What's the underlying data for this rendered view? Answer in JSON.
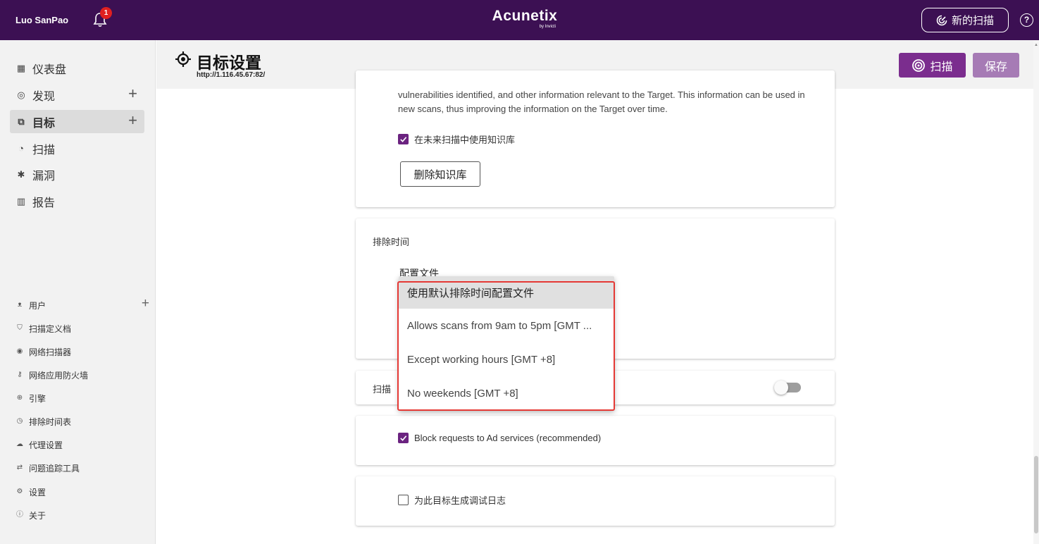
{
  "header": {
    "user_name": "Luo SanPao",
    "notification_count": "1",
    "logo_main": "Acunetix",
    "logo_sub": "by Invicti",
    "new_scan_label": "新的扫描",
    "help_label": "?"
  },
  "sidebar": {
    "nav": [
      {
        "label": "仪表盘",
        "icon": "dashboard-icon"
      },
      {
        "label": "发现",
        "icon": "discovery-icon"
      },
      {
        "label": "目标",
        "icon": "targets-icon"
      },
      {
        "label": "扫描",
        "icon": "scans-icon"
      },
      {
        "label": "漏洞",
        "icon": "bug-icon"
      },
      {
        "label": "报告",
        "icon": "reports-icon"
      }
    ],
    "settings": [
      {
        "label": "用户",
        "icon": "user-icon"
      },
      {
        "label": "扫描定义档",
        "icon": "shield-icon"
      },
      {
        "label": "网络扫描器",
        "icon": "network-scanner-icon"
      },
      {
        "label": "网络应用防火墙",
        "icon": "key-icon"
      },
      {
        "label": "引擎",
        "icon": "engine-icon"
      },
      {
        "label": "排除时间表",
        "icon": "clock-icon"
      },
      {
        "label": "代理设置",
        "icon": "proxy-icon"
      },
      {
        "label": "问题追踪工具",
        "icon": "issue-tracker-icon"
      },
      {
        "label": "设置",
        "icon": "gear-icon"
      },
      {
        "label": "关于",
        "icon": "info-icon"
      }
    ]
  },
  "page": {
    "title": "目标设置",
    "url": "http://1.116.45.67:82/",
    "scan_button": "扫描",
    "save_button": "保存"
  },
  "knowledge_base": {
    "text": "vulnerabilities identified, and other information relevant to the Target. This information can be used in new scans, thus improving the information on the Target over time.",
    "use_in_future_label": "在未来扫描中使用知识库",
    "use_in_future_checked": true,
    "delete_button": "删除知识库"
  },
  "excluded_hours": {
    "section_label": "排除时间",
    "profile_label": "配置文件",
    "options": [
      "使用默认排除时间配置文件",
      "Allows scans from 9am to 5pm [GMT ...",
      "Except working hours [GMT +8]",
      "No weekends [GMT +8]"
    ],
    "selected_index": 0
  },
  "scan_speed_row": {
    "label": "扫描",
    "toggle_on": false
  },
  "ad_block": {
    "label": "Block requests to Ad services (recommended)",
    "checked": true
  },
  "debug_log": {
    "label": "为此目标生成调试日志",
    "checked": false
  },
  "colors": {
    "topbar": "#3c1053",
    "accent": "#7b2d8e",
    "save_disabled": "#a67bb5",
    "highlight": "#e53935"
  }
}
